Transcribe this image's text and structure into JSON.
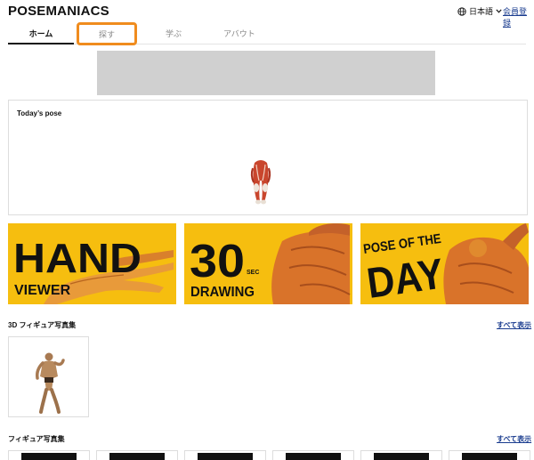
{
  "header": {
    "logo": "POSEMANIACS",
    "language_label": "日本語",
    "signup_label": "会員登録"
  },
  "tabs": [
    {
      "label": "ホーム",
      "active": true
    },
    {
      "label": "探す",
      "active": false,
      "highlighted": true
    },
    {
      "label": "学ぶ",
      "active": false
    },
    {
      "label": "アバウト",
      "active": false
    }
  ],
  "today": {
    "title": "Today’s pose"
  },
  "banners": [
    {
      "line1": "HAND",
      "line2": "VIEWER"
    },
    {
      "line1": "30",
      "sub": "SEC",
      "line2": "DRAWING"
    },
    {
      "line1": "POSE OF THE",
      "line2": "DAY"
    }
  ],
  "sections": {
    "figure3d": {
      "title": "3D フィギュア写真集",
      "link": "すべて表示"
    },
    "figure": {
      "title": "フィギュア写真集",
      "link": "すべて表示"
    }
  },
  "colors": {
    "accent_orange": "#f08c1e",
    "banner_yellow": "#f6be0f",
    "link_blue": "#1a3c8f",
    "muscle_red": "#c9462d",
    "skin_orange": "#e08a2e"
  },
  "icons": {
    "globe": "globe-icon",
    "chevron": "chevron-down-icon"
  }
}
